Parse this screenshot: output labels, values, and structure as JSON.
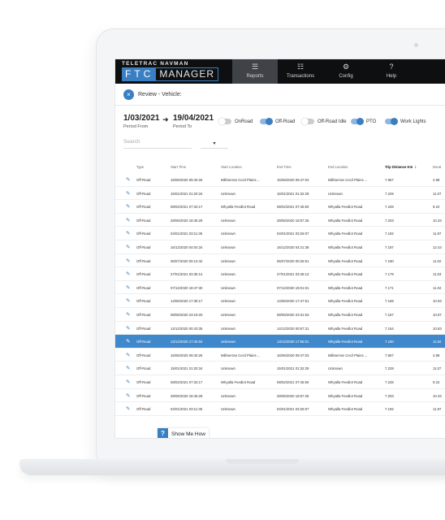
{
  "app": {
    "brand_company": "TELETRAC NAVMAN",
    "logo_ftc": "FTC",
    "logo_manager": "MANAGER"
  },
  "nav": {
    "items": [
      {
        "label": "Reports",
        "icon": "report-icon",
        "glyph": "☰",
        "active": true
      },
      {
        "label": "Transactions",
        "icon": "document-icon",
        "glyph": "☷",
        "active": false
      },
      {
        "label": "Config",
        "icon": "gear-icon",
        "glyph": "⚙",
        "active": false
      },
      {
        "label": "Help",
        "icon": "question-circle-icon",
        "glyph": "?",
        "active": false
      }
    ]
  },
  "review": {
    "close_glyph": "×",
    "title": "Review - Vehicle:"
  },
  "period": {
    "from_date": "1/03/2021",
    "from_label": "Period From",
    "to_date": "19/04/2021",
    "to_label": "Period To",
    "arrow_glyph": "➜"
  },
  "toggles": [
    {
      "label": "OnRoad",
      "on": false
    },
    {
      "label": "Off-Road",
      "on": true
    },
    {
      "label": "Off-Road Idle",
      "on": false
    },
    {
      "label": "PTO",
      "on": true
    },
    {
      "label": "Work Lights",
      "on": true
    }
  ],
  "search": {
    "placeholder": "Search",
    "dropdown_glyph": "▾"
  },
  "table": {
    "columns": [
      "Type",
      "Start Time",
      "Start Location",
      "End Time",
      "End Location",
      "Trip Distance Km",
      "Durat"
    ],
    "sort_glyph": "↓",
    "rows": [
      [
        "Off-Road",
        "16/06/2020 09:40:26",
        "Millmerran Cecil Plains ...",
        "16/06/2020 09:47:03",
        "Millmerran Cecil Plains ...",
        "7.967",
        "4.98"
      ],
      [
        "Off-Road",
        "15/01/2021 01:20:34",
        "Unknown",
        "15/01/2021 01:32:29",
        "Unknown",
        "7.229",
        "11.07"
      ],
      [
        "Off-Road",
        "08/02/2021 07:33:17",
        "Whyalla Feedlot Road",
        "08/02/2021 07:45:50",
        "Whyalla Feedlot Road",
        "7.228",
        "9.22"
      ],
      [
        "Off-Road",
        "28/06/2020 18:45:29",
        "Unknown",
        "28/06/2020 18:57:26",
        "Whyalla Feedlot Road",
        "7.203",
        "10.33"
      ],
      [
        "Off-Road",
        "04/01/2021 03:11:36",
        "Unknown",
        "04/01/2021 03:26:07",
        "Whyalla Feedlot Road",
        "7.192",
        "11.97"
      ],
      [
        "Off-Road",
        "16/12/2020 04:04:34",
        "Unknown",
        "16/12/2020 04:21:38",
        "Whyalla Feedlot Road",
        "7.187",
        "12.43"
      ],
      [
        "Off-Road",
        "06/07/2020 00:13:42",
        "Unknown",
        "06/07/2020 00:26:51",
        "Whyalla Feedlot Road",
        "7.180",
        "11.02"
      ],
      [
        "Off-Road",
        "27/01/2021 03:35:14",
        "Unknown",
        "27/01/2021 03:48:13",
        "Whyalla Feedlot Road",
        "7.179",
        "11.03"
      ],
      [
        "Off-Road",
        "07/12/2020 18:47:30",
        "Unknown",
        "07/12/2020 19:01:01",
        "Whyalla Feedlot Road",
        "7.171",
        "11.02"
      ],
      [
        "Off-Road",
        "14/06/2020 17:35:17",
        "Unknown",
        "14/06/2020 17:47:51",
        "Whyalla Feedlot Road",
        "7.169",
        "10.93"
      ],
      [
        "Off-Road",
        "08/06/2020 23:19:20",
        "Unknown",
        "08/06/2020 23:31:53",
        "Whyalla Feedlot Road",
        "7.167",
        "10.97"
      ],
      [
        "Off-Road",
        "14/12/2020 00:43:35",
        "Unknown",
        "14/12/2020 00:57:31",
        "Whyalla Feedlot Road",
        "7.164",
        "10.83"
      ],
      [
        "Off-Road",
        "13/12/2020 17:40:02",
        "Unknown",
        "13/12/2020 17:55:01",
        "Whyalla Feedlot Road",
        "7.160",
        "11.92"
      ],
      [
        "Off-Road",
        "16/06/2020 09:40:26",
        "Millmerran Cecil Plains ...",
        "16/06/2020 09:47:03",
        "Millmerran Cecil Plains ...",
        "7.967",
        "4.98"
      ],
      [
        "Off-Road",
        "15/01/2021 01:20:34",
        "Unknown",
        "15/01/2021 01:32:29",
        "Unknown",
        "7.229",
        "11.07"
      ],
      [
        "Off-Road",
        "08/02/2021 07:33:17",
        "Whyalla Feedlot Road",
        "08/02/2021 07:45:50",
        "Whyalla Feedlot Road",
        "7.228",
        "9.22"
      ],
      [
        "Off-Road",
        "28/06/2020 18:45:29",
        "Unknown",
        "28/06/2020 18:57:26",
        "Whyalla Feedlot Road",
        "7.203",
        "10.33"
      ],
      [
        "Off-Road",
        "04/01/2021 03:11:36",
        "Unknown",
        "04/01/2021 03:26:07",
        "Whyalla Feedlot Road",
        "7.192",
        "11.97"
      ]
    ],
    "selected_row_index": 12,
    "edit_icon_glyph": "✎"
  },
  "help_widget": {
    "glyph": "?",
    "label": "Show Me How"
  },
  "colors": {
    "accent": "#3a7fc1",
    "topbar": "#0e0f10",
    "selected_row": "#3f88cc"
  }
}
